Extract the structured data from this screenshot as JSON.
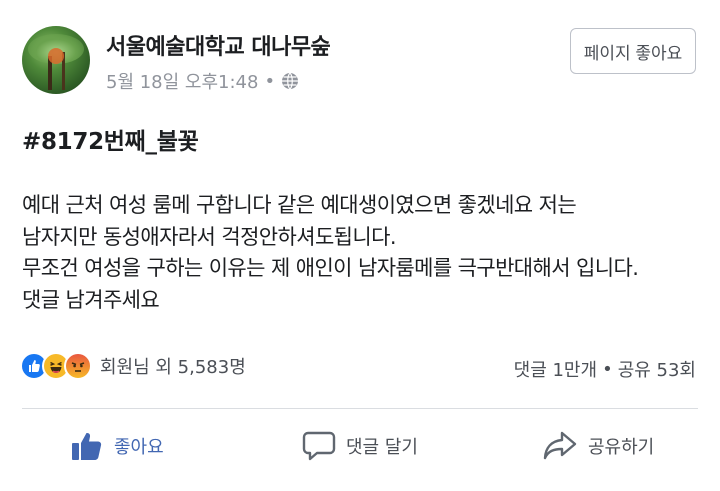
{
  "post": {
    "page_name": "서울예술대학교 대나무숲",
    "timestamp": "5월 18일 오후1:48",
    "meta_separator": "•",
    "like_page_label": "페이지 좋아요",
    "hashtag": "#8172번째_불꽃",
    "body_lines": [
      "예대 근처 여성 룸메 구합니다  같은 예대생이였으면 좋겠네요  저는",
      "남자지만 동성애자라서 걱정안하셔도됩니다.",
      "무조건 여성을 구하는 이유는 제 애인이 남자룸메를 극구반대해서 입니다.",
      "댓글 남겨주세요"
    ]
  },
  "engagement": {
    "reaction_icons": [
      "like-reaction-icon",
      "haha-reaction-icon",
      "angry-reaction-icon"
    ],
    "reaction_summary": "회원님 외 5,583명",
    "comments": "댓글 1만개",
    "stats_separator": "•",
    "shares": "공유 53회"
  },
  "actions": {
    "like_label": "좋아요",
    "comment_label": "댓글 달기",
    "share_label": "공유하기"
  },
  "colors": {
    "accent": "#4267b2",
    "text": "#1c1e21",
    "muted": "#90949c",
    "like_reaction": "#1877f2",
    "haha_reaction": "#f7b928",
    "angry_reaction": "#e9710f"
  }
}
